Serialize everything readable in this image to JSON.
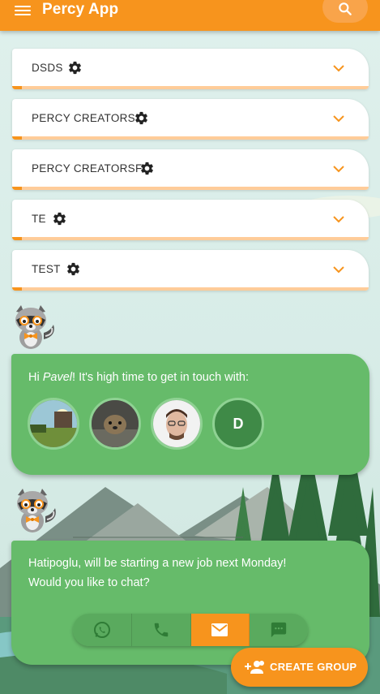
{
  "app": {
    "title": "Percy App"
  },
  "groups": [
    {
      "name": "DSDS"
    },
    {
      "name": "PERCY CREATORS"
    },
    {
      "name": "PERCY CREATORSF"
    },
    {
      "name": "TE"
    },
    {
      "name": "TEST"
    }
  ],
  "reminder": {
    "greeting": "Hi ",
    "user_name": "Pavel",
    "message": "! It's high time to get in touch with:",
    "contacts": [
      {
        "type": "photo",
        "icon": "landscape-photo"
      },
      {
        "type": "photo",
        "icon": "animal-photo"
      },
      {
        "type": "photo",
        "icon": "person-photo"
      },
      {
        "type": "initial",
        "initial": "D"
      }
    ]
  },
  "news": {
    "line1": "Hatipoglu, will be starting a new job next Monday!",
    "line2": "Would you like to chat?",
    "actions": [
      {
        "icon": "whatsapp-icon",
        "active": false
      },
      {
        "icon": "phone-icon",
        "active": false
      },
      {
        "icon": "email-icon",
        "active": true
      },
      {
        "icon": "message-icon",
        "active": false
      }
    ]
  },
  "fab": {
    "label": "CREATE GROUP",
    "icon": "group-add-icon"
  },
  "colors": {
    "primary": "#f7941d",
    "card_green": "#66bb6a",
    "accent_light": "#ffcc99"
  }
}
